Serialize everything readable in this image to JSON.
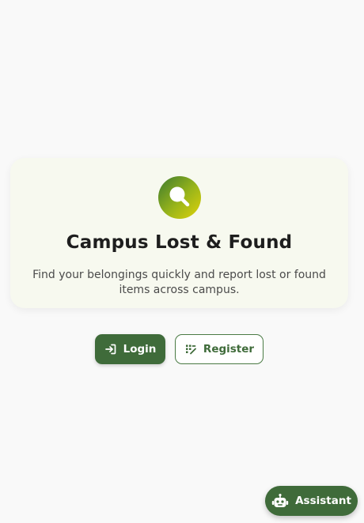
{
  "hero": {
    "logo_icon": "search-magnifier-icon",
    "title": "Campus Lost & Found",
    "subtitle": "Find your belongings quickly and report lost or found items across campus."
  },
  "actions": {
    "login": {
      "label": "Login",
      "icon": "login-arrow-icon"
    },
    "register": {
      "label": "Register",
      "icon": "register-form-icon"
    }
  },
  "assistant": {
    "label": "Assistant",
    "icon": "robot-icon"
  },
  "colors": {
    "primary": "#3f6b3a",
    "card_background": "#f7f9ef",
    "page_background": "#f9f9f9",
    "gradient_start": "#3c7a2e",
    "gradient_end": "#e0d20a"
  }
}
